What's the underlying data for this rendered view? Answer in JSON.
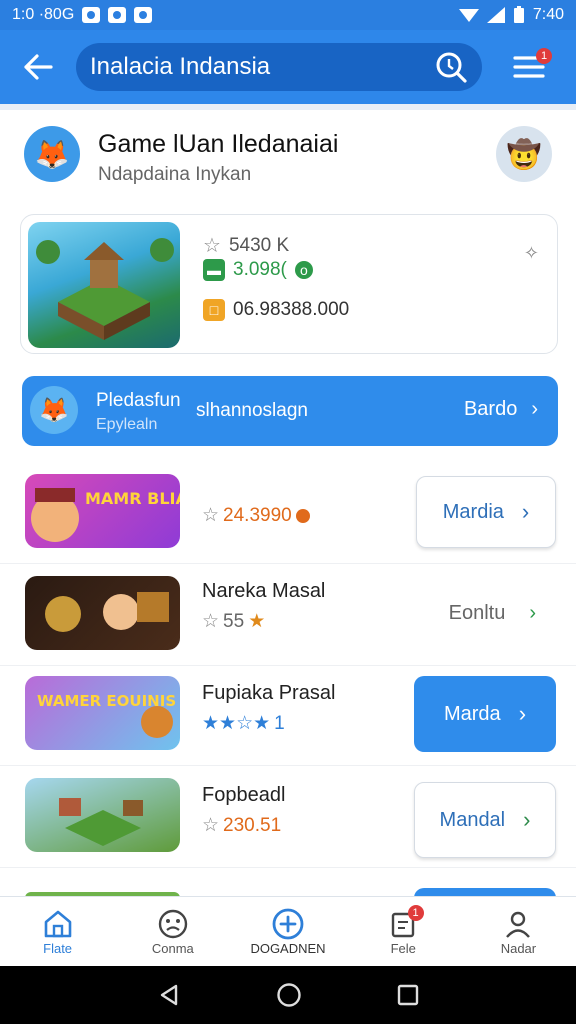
{
  "status": {
    "left": "1:0 ·80G",
    "time": "7:40"
  },
  "search": {
    "query": "Inalacia Indansia"
  },
  "menu": {
    "badge": "1"
  },
  "profile": {
    "title": "Game lUan Iledanaiai",
    "subtitle": "Ndapdaina Inykan"
  },
  "feature": {
    "stars": "5430 K",
    "price": "3.098(",
    "code": "06.98388.000"
  },
  "banner": {
    "line1": "Pledasfun",
    "line2": "Epylealn",
    "middle": "slhannoslagn",
    "action": "Bardo"
  },
  "rows": [
    {
      "title": "",
      "rating": "24.3990",
      "button": "Mardia",
      "button_style": "outline"
    },
    {
      "title": "Nareka Masal",
      "rating": "55",
      "button": "Eonltu",
      "button_style": "plain"
    },
    {
      "title": "Fupiaka Prasal",
      "rating": "1",
      "button": "Marda",
      "button_style": "filled"
    },
    {
      "title": "Fopbeadl",
      "rating": "230.51",
      "button": "Mandal",
      "button_style": "outline"
    }
  ],
  "thumb_texts": {
    "row1": "MAMR BLIAN SOYAI",
    "row3": "WAMER EOUINIS"
  },
  "bottom_nav": [
    {
      "label": "Flate",
      "icon": "home-icon"
    },
    {
      "label": "Conma",
      "icon": "face-icon"
    },
    {
      "label": "DOGADNEN",
      "icon": "add-circle-icon"
    },
    {
      "label": "Fele",
      "icon": "file-icon"
    },
    {
      "label": "Nadar",
      "icon": "person-icon"
    }
  ],
  "colors": {
    "primary": "#2e87ea",
    "dark_primary": "#1864c4",
    "star_orange": "#e06a1b",
    "green": "#2d9a4a"
  }
}
